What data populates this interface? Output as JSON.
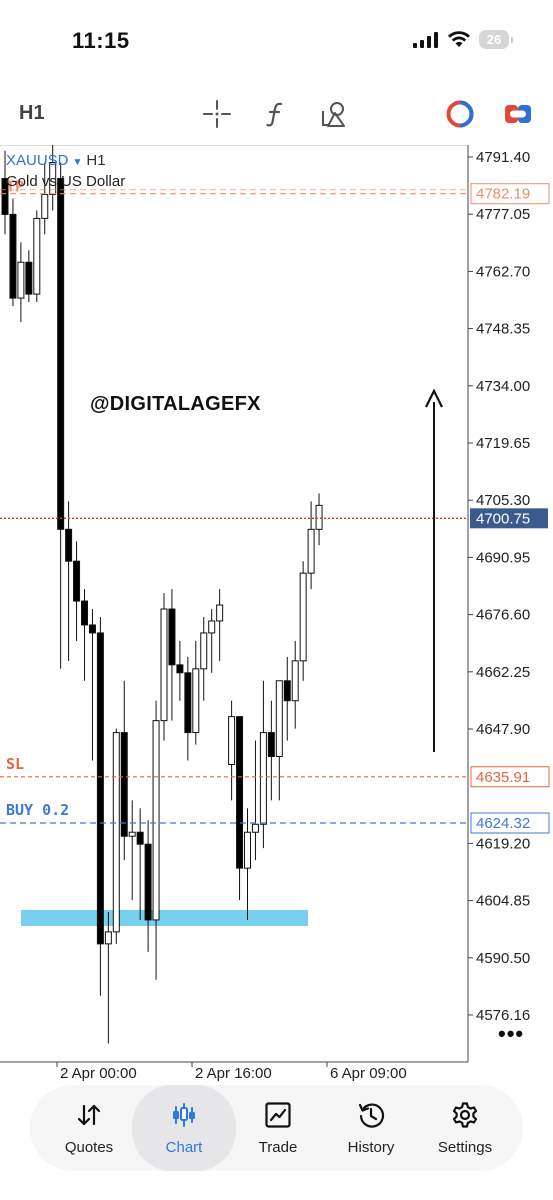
{
  "status_bar": {
    "time": "11:15",
    "battery": "26",
    "signal_icon": "cellular-signal-icon",
    "wifi_icon": "wifi-icon"
  },
  "toolbar": {
    "timeframe": "H1",
    "tools": [
      "crosshair-icon",
      "indicator-function-icon",
      "objects-shapes-icon",
      "one-click-trading-icon",
      "trade-toggle-icon"
    ]
  },
  "chart": {
    "symbol": "XAUUSD",
    "timeframe": "H1",
    "description": "Gold vs US Dollar",
    "watermark": "@DIGITALAGEFX",
    "more_icon": "•••",
    "bid_price": "4700.75",
    "price_axis": [
      "4791.40",
      "4777.05",
      "4762.70",
      "4748.35",
      "4734.00",
      "4719.65",
      "4705.30",
      "4690.95",
      "4676.60",
      "4662.25",
      "4647.90",
      "4619.20",
      "4604.85",
      "4590.50",
      "4576.16"
    ],
    "time_axis": [
      "2 Apr 00:00",
      "2 Apr 16:00",
      "6 Apr 09:00"
    ],
    "levels": [
      {
        "label": "TP",
        "price": "4782.19",
        "color": "#ee8c6c"
      },
      {
        "label": "SL",
        "price": "4635.91",
        "color": "#e8643f"
      },
      {
        "label": "BUY 0.2",
        "price": "4624.32",
        "color": "#3f78d8"
      }
    ],
    "colors": {
      "bid_line": "#c0392b",
      "bid_tag": "#3a5b8c",
      "zone": "#79cff0",
      "bull_candle": "#ffffff",
      "bear_candle": "#000000"
    }
  },
  "chart_data": {
    "type": "candlestick",
    "symbol": "XAUUSD",
    "timeframe": "H1",
    "y_range": [
      4566,
      4798
    ],
    "candles": [
      {
        "o": 4786,
        "h": 4793,
        "l": 4772,
        "c": 4777
      },
      {
        "o": 4777,
        "h": 4781,
        "l": 4754,
        "c": 4756
      },
      {
        "o": 4756,
        "h": 4770,
        "l": 4750,
        "c": 4765
      },
      {
        "o": 4765,
        "h": 4768,
        "l": 4755,
        "c": 4757
      },
      {
        "o": 4757,
        "h": 4778,
        "l": 4755,
        "c": 4776
      },
      {
        "o": 4776,
        "h": 4790,
        "l": 4772,
        "c": 4782
      },
      {
        "o": 4782,
        "h": 4797,
        "l": 4778,
        "c": 4790
      },
      {
        "o": 4786,
        "h": 4790,
        "l": 4663,
        "c": 4698
      },
      {
        "o": 4698,
        "h": 4705,
        "l": 4665,
        "c": 4690
      },
      {
        "o": 4690,
        "h": 4695,
        "l": 4670,
        "c": 4680
      },
      {
        "o": 4680,
        "h": 4683,
        "l": 4660,
        "c": 4674
      },
      {
        "o": 4674,
        "h": 4678,
        "l": 4640,
        "c": 4672
      },
      {
        "o": 4672,
        "h": 4676,
        "l": 4581,
        "c": 4594
      },
      {
        "o": 4594,
        "h": 4602,
        "l": 4569,
        "c": 4597
      },
      {
        "o": 4597,
        "h": 4648,
        "l": 4594,
        "c": 4647
      },
      {
        "o": 4647,
        "h": 4660,
        "l": 4615,
        "c": 4621
      },
      {
        "o": 4621,
        "h": 4630,
        "l": 4605,
        "c": 4622
      },
      {
        "o": 4622,
        "h": 4628,
        "l": 4600,
        "c": 4619
      },
      {
        "o": 4619,
        "h": 4625,
        "l": 4592,
        "c": 4600
      },
      {
        "o": 4600,
        "h": 4655,
        "l": 4585,
        "c": 4650
      },
      {
        "o": 4650,
        "h": 4682,
        "l": 4645,
        "c": 4678
      },
      {
        "o": 4678,
        "h": 4683,
        "l": 4650,
        "c": 4664
      },
      {
        "o": 4664,
        "h": 4670,
        "l": 4655,
        "c": 4662
      },
      {
        "o": 4662,
        "h": 4666,
        "l": 4640,
        "c": 4647
      },
      {
        "o": 4647,
        "h": 4670,
        "l": 4644,
        "c": 4663
      },
      {
        "o": 4663,
        "h": 4676,
        "l": 4655,
        "c": 4672
      },
      {
        "o": 4672,
        "h": 4678,
        "l": 4662,
        "c": 4675
      },
      {
        "o": 4675,
        "h": 4683,
        "l": 4665,
        "c": 4679
      },
      {
        "o": 4639,
        "h": 4655,
        "l": 4630,
        "c": 4651
      },
      {
        "o": 4651,
        "h": 4650,
        "l": 4605,
        "c": 4613
      },
      {
        "o": 4613,
        "h": 4628,
        "l": 4600,
        "c": 4622
      },
      {
        "o": 4622,
        "h": 4645,
        "l": 4615,
        "c": 4624
      },
      {
        "o": 4624,
        "h": 4660,
        "l": 4618,
        "c": 4647
      },
      {
        "o": 4647,
        "h": 4655,
        "l": 4630,
        "c": 4641
      },
      {
        "o": 4641,
        "h": 4660,
        "l": 4630,
        "c": 4660
      },
      {
        "o": 4660,
        "h": 4666,
        "l": 4645,
        "c": 4655
      },
      {
        "o": 4655,
        "h": 4670,
        "l": 4648,
        "c": 4665
      },
      {
        "o": 4665,
        "h": 4690,
        "l": 4660,
        "c": 4687
      },
      {
        "o": 4687,
        "h": 4705,
        "l": 4683,
        "c": 4698
      },
      {
        "o": 4698,
        "h": 4707,
        "l": 4694,
        "c": 4704
      }
    ],
    "demand_zone": {
      "from": 4598,
      "to": 4602
    }
  },
  "nav": {
    "items": [
      {
        "label": "Quotes",
        "icon": "quotes-arrows-icon",
        "active": false
      },
      {
        "label": "Chart",
        "icon": "candlestick-chart-icon",
        "active": true
      },
      {
        "label": "Trade",
        "icon": "trade-line-chart-icon",
        "active": false
      },
      {
        "label": "History",
        "icon": "history-clock-icon",
        "active": false
      },
      {
        "label": "Settings",
        "icon": "settings-gear-icon",
        "active": false
      }
    ]
  }
}
